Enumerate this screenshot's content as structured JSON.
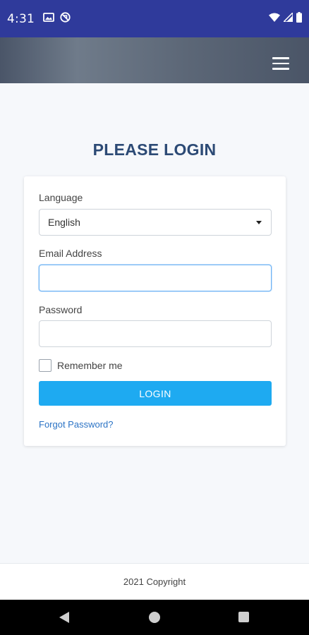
{
  "status_bar": {
    "time": "4:31",
    "left_icons": [
      "gallery-icon",
      "no-sync-icon"
    ],
    "right_icons": [
      "wifi-icon",
      "signal-icon",
      "battery-icon"
    ]
  },
  "header": {
    "menu_icon": "hamburger-menu-icon"
  },
  "page": {
    "title": "PLEASE LOGIN"
  },
  "form": {
    "language_label": "Language",
    "language_value": "English",
    "email_label": "Email Address",
    "email_value": "",
    "password_label": "Password",
    "password_value": "",
    "remember_label": "Remember me",
    "remember_checked": false,
    "login_button": "LOGIN",
    "forgot_link": "Forgot Password?"
  },
  "footer": {
    "text": "2021 Copyright"
  },
  "nav_bar": {
    "icons": [
      "back-icon",
      "home-icon",
      "recents-icon"
    ]
  },
  "colors": {
    "status_bar": "#2f3a9b",
    "header": "#5c6777",
    "title": "#2c4a75",
    "button": "#1eaaf1",
    "link": "#2b73c5"
  }
}
